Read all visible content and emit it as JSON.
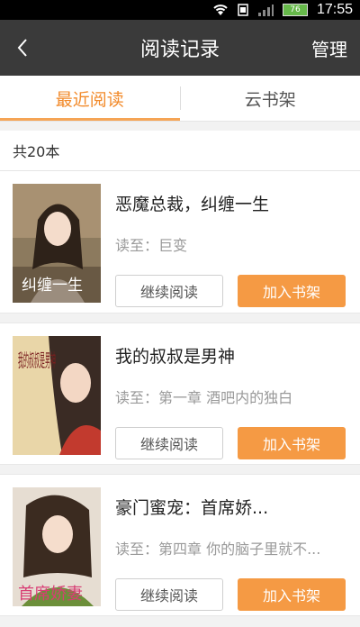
{
  "status_bar": {
    "time": "17:55",
    "battery": "76"
  },
  "header": {
    "title": "阅读记录",
    "manage": "管理"
  },
  "tabs": [
    {
      "label": "最近阅读",
      "active": true
    },
    {
      "label": "云书架",
      "active": false
    }
  ],
  "count": "共20本",
  "books": [
    {
      "title": "恶魔总裁，纠缠一生",
      "read_to": "读至：巨变",
      "cover_text": "纠缠一生",
      "continue_label": "继续阅读",
      "add_label": "加入书架"
    },
    {
      "title": "我的叔叔是男神",
      "read_to": "读至：第一章  酒吧内的独白",
      "cover_text": "我的叔叔是男神",
      "continue_label": "继续阅读",
      "add_label": "加入书架"
    },
    {
      "title": "豪门蜜宠：首席娇...",
      "read_to": "读至：第四章 你的脑子里就不...",
      "cover_text": "首席娇妻",
      "continue_label": "继续阅读",
      "add_label": "加入书架"
    }
  ],
  "colors": {
    "accent": "#f28a2a",
    "button": "#f59a44",
    "header_bg": "#3a3a3a"
  }
}
